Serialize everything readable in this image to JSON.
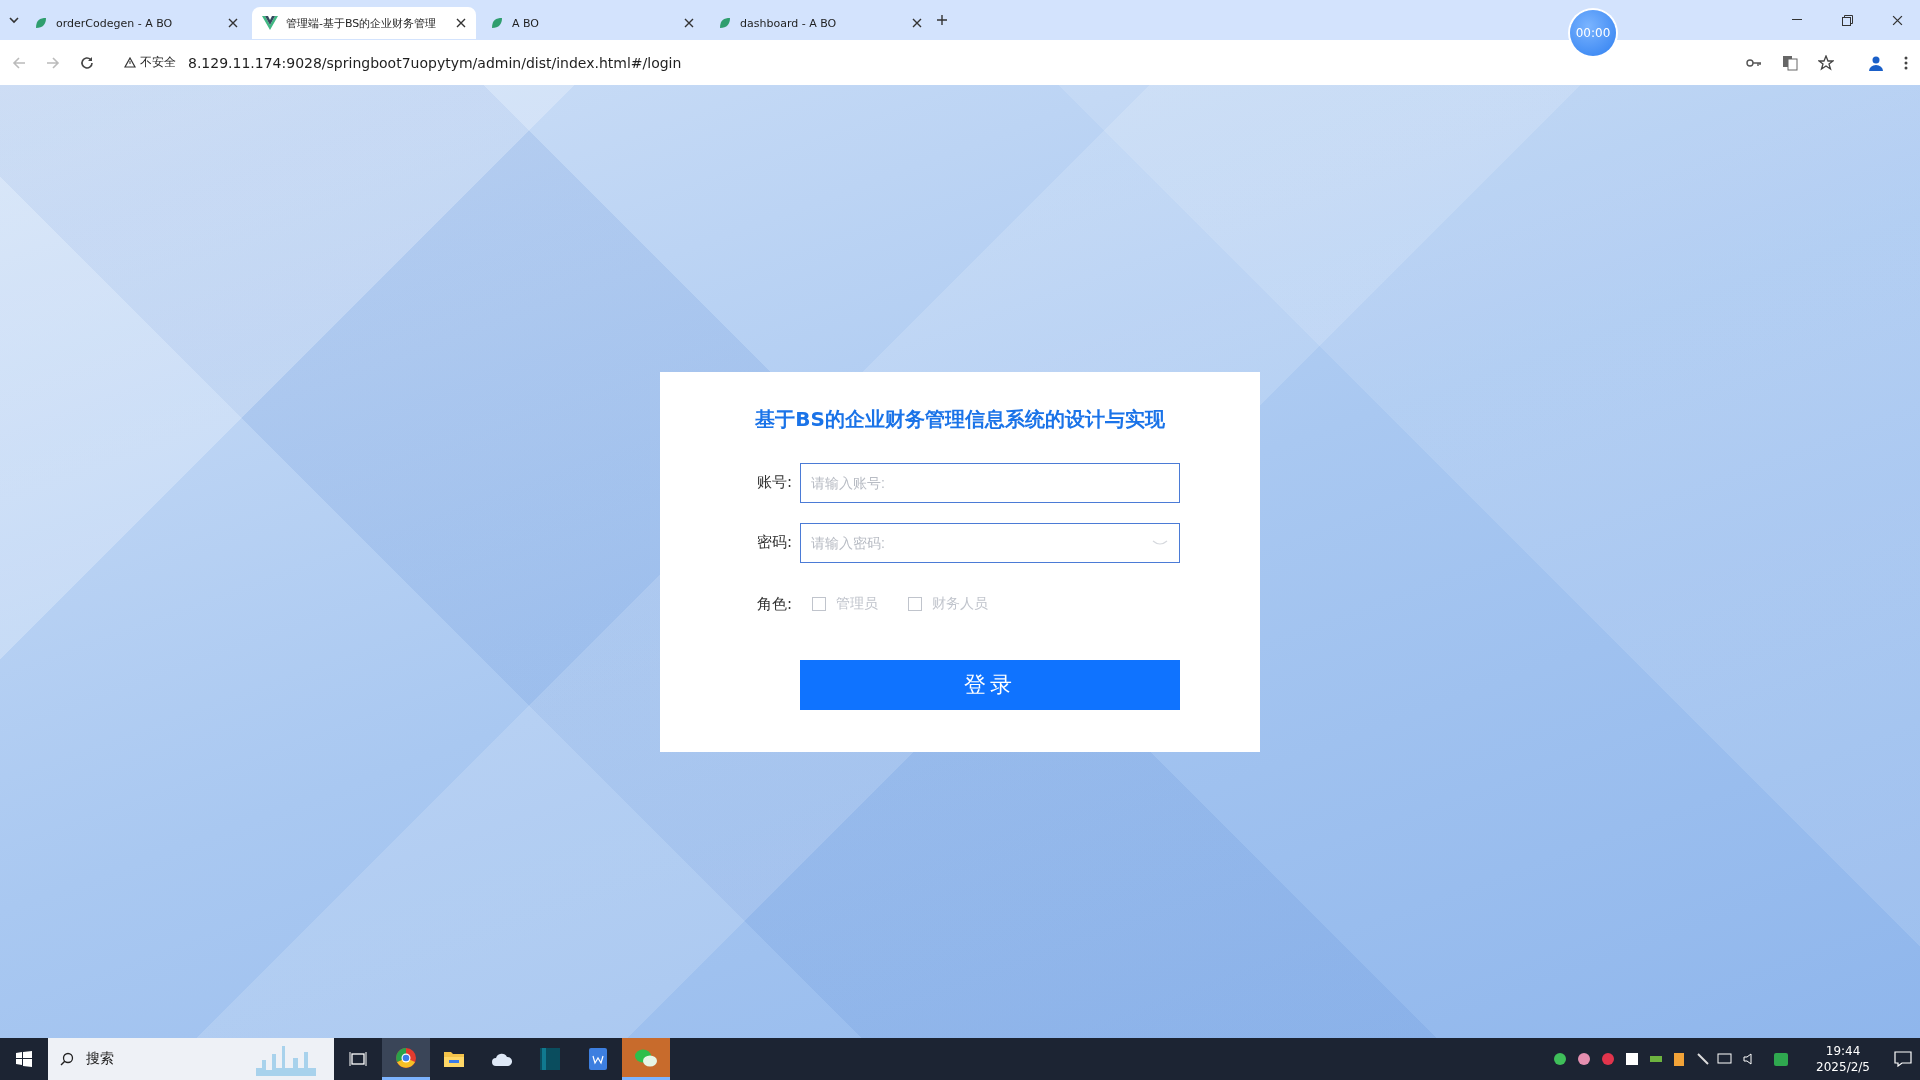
{
  "browser": {
    "tabs": [
      {
        "title": "orderCodegen - A BO",
        "selected": false,
        "kind": "leaf"
      },
      {
        "title": "管理端-基于BS的企业财务管理",
        "selected": true,
        "kind": "vue"
      },
      {
        "title": "A BO",
        "selected": false,
        "kind": "leaf"
      },
      {
        "title": "dashboard - A BO",
        "selected": false,
        "kind": "leaf"
      }
    ],
    "security": "不安全",
    "url": "8.129.11.174:9028/springboot7uopytym/admin/dist/index.html#/login"
  },
  "recorder": {
    "time": "00:00"
  },
  "login": {
    "title": "基于BS的企业财务管理信息系统的设计与实现",
    "fields": [
      {
        "label": "账号:",
        "placeholder": "请输入账号:",
        "kind": "text"
      },
      {
        "label": "密码:",
        "placeholder": "请输入密码:",
        "kind": "password"
      }
    ],
    "role_label": "角色:",
    "roles": [
      {
        "label": "管理员",
        "checked": false
      },
      {
        "label": "财务人员",
        "checked": false
      }
    ],
    "submit": "登录"
  },
  "taskbar": {
    "search_placeholder": "搜索",
    "apps": [
      {
        "kind": "browser",
        "active": true
      },
      {
        "kind": "folder",
        "active": false
      },
      {
        "kind": "cloud",
        "active": false
      },
      {
        "kind": "editor",
        "active": false
      },
      {
        "kind": "document",
        "active": false
      },
      {
        "kind": "chat",
        "active": true
      }
    ],
    "time": "19:44",
    "date": "2025/2/5"
  }
}
